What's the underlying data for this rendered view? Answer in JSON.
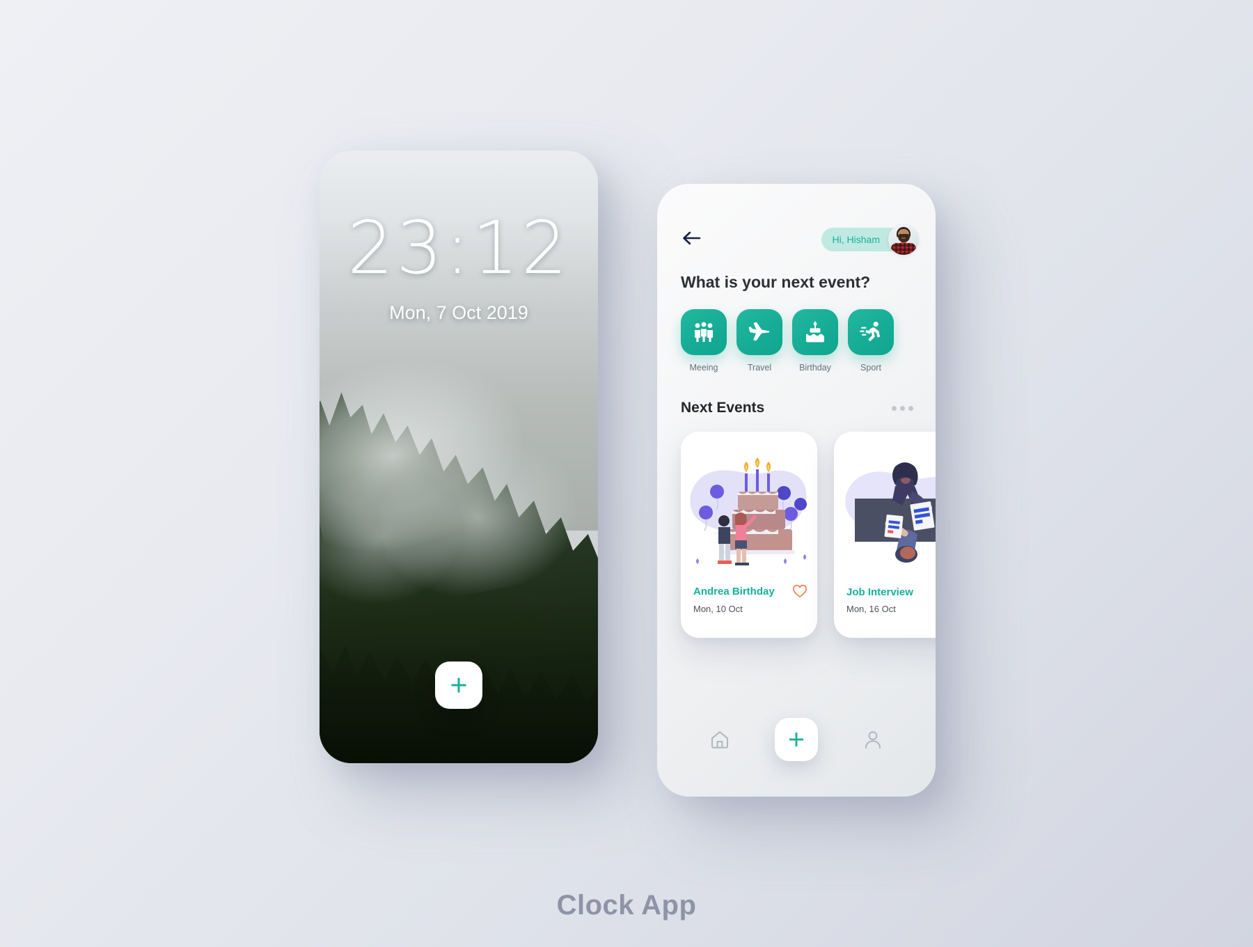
{
  "background": {
    "gradient_from": "#eef0f4",
    "gradient_to": "#d2d5e0"
  },
  "caption": "Clock App",
  "accent": {
    "teal": "#16b09a",
    "teal_pill_bg": "#bfe9e1",
    "heart_orange": "#e8794a",
    "navy": "#15233f"
  },
  "lock_screen": {
    "time": "23:12",
    "date": "Mon, 7 Oct 2019",
    "wallpaper": "misty-forest-photo",
    "add_button_icon": "plus-icon"
  },
  "app_screen": {
    "back_icon": "arrow-left-icon",
    "greeting": "Hi, Hisham",
    "avatar_alt": "user-avatar-photo",
    "question": "What is your next event?",
    "categories": [
      {
        "label": "Meeing",
        "icon": "people-icon"
      },
      {
        "label": "Travel",
        "icon": "airplane-icon"
      },
      {
        "label": "Birthday",
        "icon": "cake-icon"
      },
      {
        "label": "Sport",
        "icon": "running-icon"
      }
    ],
    "events_section": {
      "title": "Next Events",
      "more_icon": "ellipsis-icon",
      "cards": [
        {
          "title": "Andrea Birthday",
          "date": "Mon, 10 Oct",
          "art": "birthday-cake-illustration",
          "favorite_icon": "heart-outline-icon",
          "has_favorite": true
        },
        {
          "title": "Job Interview",
          "date": "Mon, 16 Oct",
          "art": "job-interview-illustration",
          "favorite_icon": "",
          "has_favorite": false
        }
      ]
    },
    "bottom_nav": [
      {
        "name": "home",
        "icon": "home-icon"
      },
      {
        "name": "add",
        "icon": "plus-icon"
      },
      {
        "name": "profile",
        "icon": "person-icon"
      }
    ]
  }
}
